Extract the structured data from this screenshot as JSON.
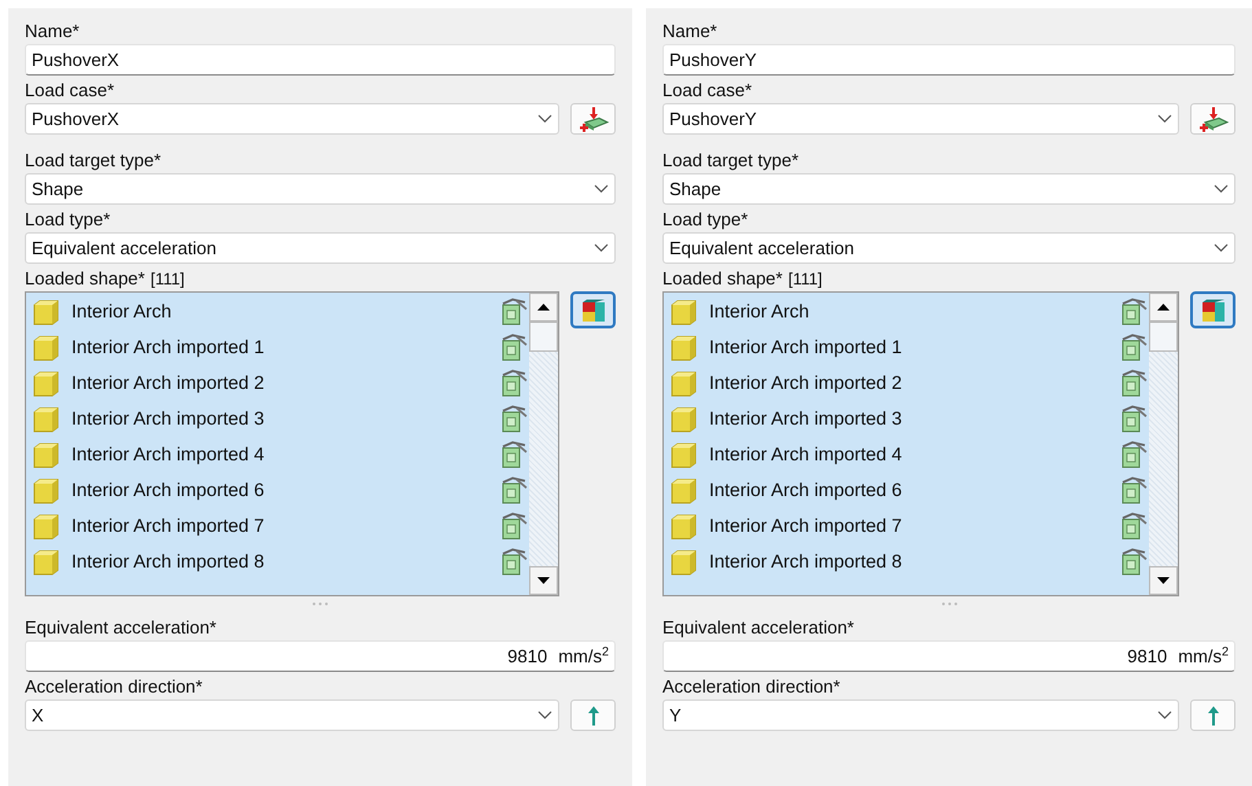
{
  "panels": [
    {
      "fields": [
        {
          "kind": "text",
          "label": "Name*",
          "value": "PushoverX"
        },
        {
          "kind": "loadcase",
          "label": "Load case*",
          "value": "PushoverX"
        },
        {
          "kind": "select",
          "label": "Load target type*",
          "value": "Shape"
        },
        {
          "kind": "select",
          "label": "Load type*",
          "value": "Equivalent acceleration"
        },
        {
          "kind": "shapes",
          "label": "Loaded shape*",
          "count": "[111]",
          "items": [
            "Interior Arch",
            "Interior Arch imported 1",
            "Interior Arch imported 2",
            "Interior Arch imported 3",
            "Interior Arch imported 4",
            "Interior Arch imported 6",
            "Interior Arch imported 7",
            "Interior Arch imported 8"
          ]
        },
        {
          "kind": "number",
          "label": "Equivalent acceleration*",
          "value": "9810",
          "unit": "mm/s$^{2}$"
        },
        {
          "kind": "direction",
          "label": "Acceleration direction*",
          "value": "X"
        }
      ]
    },
    {
      "fields": [
        {
          "kind": "text",
          "label": "Name*",
          "value": "PushoverY"
        },
        {
          "kind": "loadcase",
          "label": "Load case*",
          "value": "PushoverY"
        },
        {
          "kind": "select",
          "label": "Load target type*",
          "value": "Shape"
        },
        {
          "kind": "select",
          "label": "Load type*",
          "value": "Equivalent acceleration"
        },
        {
          "kind": "shapes",
          "label": "Loaded shape*",
          "count": "[111]",
          "items": [
            "Interior Arch",
            "Interior Arch imported 1",
            "Interior Arch imported 2",
            "Interior Arch imported 3",
            "Interior Arch imported 4",
            "Interior Arch imported 6",
            "Interior Arch imported 7",
            "Interior Arch imported 8"
          ]
        },
        {
          "kind": "number",
          "label": "Equivalent acceleration*",
          "value": "9810",
          "unit": "mm/s$^{2}$"
        },
        {
          "kind": "direction",
          "label": "Acceleration direction*",
          "value": "Y"
        }
      ]
    }
  ]
}
